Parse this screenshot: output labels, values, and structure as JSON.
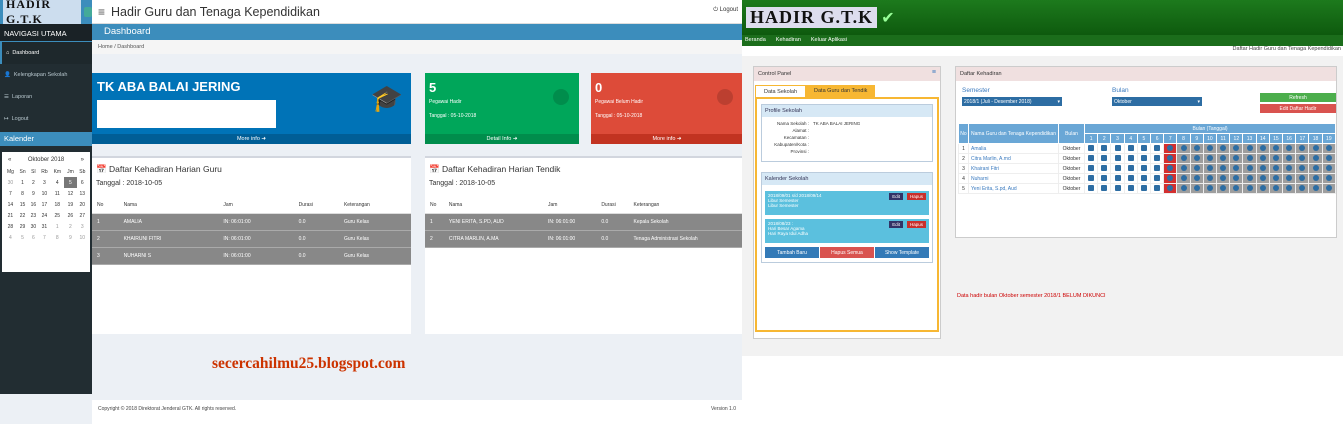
{
  "left_app": {
    "brand": "HADIR G.T.K",
    "title": "Hadir Guru dan Tenaga Kependidikan",
    "logout": "Logout",
    "sidebar": {
      "nav_header": "NAVIGASI UTAMA",
      "items": [
        {
          "icon": "home-icon",
          "label": "Dashboard"
        },
        {
          "icon": "user-icon",
          "label": "Kelengkapan Sekolah"
        },
        {
          "icon": "list-icon",
          "label": "Laporan"
        },
        {
          "icon": "logout-icon",
          "label": "Logout"
        }
      ],
      "calendar_header": "Kalender",
      "calendar": {
        "month": "Oktober 2018",
        "prev": "«",
        "next": "»",
        "days": [
          "Mg",
          "Sn",
          "Sl",
          "Rb",
          "Km",
          "Jm",
          "Sb"
        ],
        "weeks": [
          [
            "30",
            "1",
            "2",
            "3",
            "4",
            "5",
            "6"
          ],
          [
            "7",
            "8",
            "9",
            "10",
            "11",
            "12",
            "13"
          ],
          [
            "14",
            "15",
            "16",
            "17",
            "18",
            "19",
            "20"
          ],
          [
            "21",
            "22",
            "23",
            "24",
            "25",
            "26",
            "27"
          ],
          [
            "28",
            "29",
            "30",
            "31",
            "1",
            "2",
            "3"
          ],
          [
            "4",
            "5",
            "6",
            "7",
            "8",
            "9",
            "10"
          ]
        ],
        "today": "5"
      }
    },
    "header": "Dashboard",
    "breadcrumb": "Home / Dashboard",
    "school_box": {
      "name": "TK ABA BALAI JERING",
      "footer": "More info"
    },
    "hadir_box": {
      "count": "5",
      "label": "Pegawai Hadir",
      "date": "Tanggal : 05-10-2018",
      "footer": "Detail Info"
    },
    "belum_box": {
      "count": "0",
      "label": "Pegawai Belum Hadir",
      "date": "Tanggal : 05-10-2018",
      "footer": "More info"
    },
    "guru_panel": {
      "title": "Daftar Kehadiran Harian Guru",
      "date": "Tanggal : 2018-10-05",
      "columns": [
        "No",
        "Nama",
        "Jam",
        "Durasi",
        "Keterangan"
      ],
      "rows": [
        [
          "1",
          "AMALIA",
          "IN: 06:01:00",
          "0.0",
          "Guru Kelas"
        ],
        [
          "2",
          "KHAIRUNI FITRI",
          "IN: 06:01:00",
          "0.0",
          "Guru Kelas"
        ],
        [
          "3",
          "NUHARNI S",
          "IN: 06:01:00",
          "0.0",
          "Guru Kelas"
        ]
      ]
    },
    "tendik_panel": {
      "title": "Daftar Kehadiran Harian Tendik",
      "date": "Tanggal : 2018-10-05",
      "columns": [
        "No",
        "Nama",
        "Jam",
        "Durasi",
        "Keterangan"
      ],
      "rows": [
        [
          "1",
          "YENI ERITA, S.PD, AUD",
          "IN: 06:01:00",
          "0.0",
          "Kepala Sekolah"
        ],
        [
          "2",
          "CITRA MARLIN, A.MA",
          "IN: 06:01:00",
          "0.0",
          "Tenaga Administrasi Sekolah"
        ]
      ]
    },
    "watermark": "secercahilmu25.blogspot.com",
    "footer": "Copyright © 2018 Direktorat Jenderal GTK. All rights reserved.",
    "version": "Version 1.0"
  },
  "right_app": {
    "brand": "HADIR G.T.K",
    "menu": [
      "Beranda",
      "Kehadiran",
      "Keluar Aplikasi"
    ],
    "subtitle": "Daftar Hadir Guru dan Tenaga Kependidikan",
    "control_panel": {
      "title": "Control Panel",
      "tabs": [
        "Data Sekolah",
        "Data Guru dan Tendik"
      ],
      "profile_title": "Profile Sekolah",
      "profile_rows": [
        {
          "k": "Nama Sekolah :",
          "v": "TK ABA BALAI JERING"
        },
        {
          "k": "Alamat :",
          "v": ""
        },
        {
          "k": "Kecamatan :",
          "v": ""
        },
        {
          "k": "Kabupaten/Kota :",
          "v": ""
        },
        {
          "k": "Provinsi :",
          "v": ""
        }
      ],
      "agenda_title": "Kalender Sekolah",
      "agenda": [
        {
          "date": "2018/09/01 s/d 2018/09/14",
          "lines": [
            "Libur Semester",
            "Libur Semester"
          ]
        },
        {
          "date": "2018/08/23 :",
          "lines": [
            "Hari Besar Agama",
            "Hari Raya Idul Adha"
          ]
        }
      ],
      "edit": "Edit",
      "delete": "Hapus",
      "buttons": [
        "Tambah Baru",
        "Hapus Semua",
        "Show Template"
      ]
    },
    "attendance_panel": {
      "title": "Daftar Kehadiran",
      "semester_label": "Semester",
      "semester_value": "2018/1 (Juli - Desember 2018)",
      "month_label": "Bulan",
      "month_value": "Oktober",
      "btn_refresh": "Refresh",
      "btn_edit": "Edit Daftar Hadir",
      "col_no": "No",
      "col_name": "Nama Guru dan Tenaga Kependidikan",
      "col_month": "Bulan",
      "col_date": "Bulan (Tanggal)",
      "days": [
        "1",
        "2",
        "3",
        "4",
        "5",
        "6",
        "7",
        "8",
        "9",
        "10",
        "11",
        "12",
        "13",
        "14",
        "15",
        "16",
        "17",
        "18",
        "19"
      ],
      "rows": [
        {
          "no": "1",
          "name": "Amalia",
          "month": "Oktober"
        },
        {
          "no": "2",
          "name": "Citra Marlin, A.md",
          "month": "Oktober"
        },
        {
          "no": "3",
          "name": "Khairani Fitri",
          "month": "Oktober"
        },
        {
          "no": "4",
          "name": "Nuharni",
          "month": "Oktober"
        },
        {
          "no": "5",
          "name": "Yeni Erita, S.pd, Aud",
          "month": "Oktober"
        }
      ],
      "note": "Data hadir bulan Oktober semester 2018/1 BELUM DIKUNCI"
    }
  },
  "colors": {
    "blue": "#0073b7",
    "green": "#00a65a",
    "red": "#dd4b39",
    "header_green": "#1d7a1d"
  }
}
